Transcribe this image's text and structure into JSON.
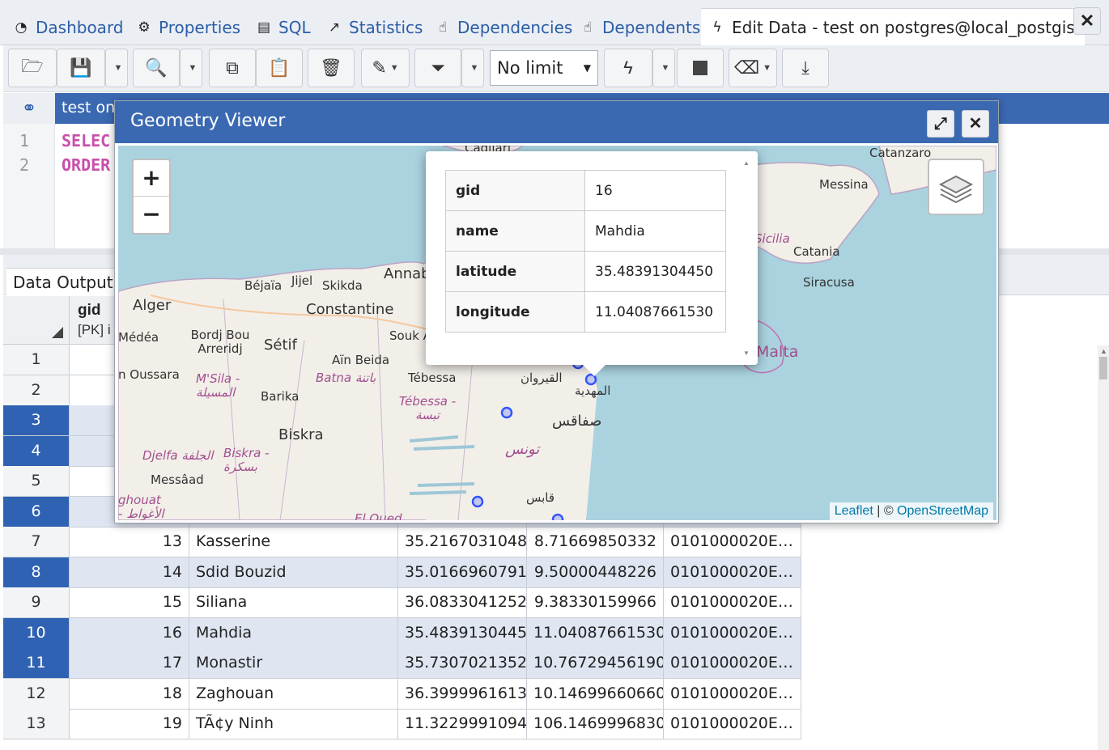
{
  "tabs": [
    {
      "label": "Dashboard",
      "icon": "dashboard-icon"
    },
    {
      "label": "Properties",
      "icon": "gears-icon"
    },
    {
      "label": "SQL",
      "icon": "file-icon"
    },
    {
      "label": "Statistics",
      "icon": "line-chart-icon"
    },
    {
      "label": "Dependencies",
      "icon": "hand-icon"
    },
    {
      "label": "Dependents",
      "icon": "hand-icon"
    },
    {
      "label": "Edit Data - test on postgres@local_postgis",
      "icon": "bolt-icon"
    }
  ],
  "toolbar": {
    "limit_value": "No limit"
  },
  "editor": {
    "connection_label": "test on",
    "lines": [
      {
        "num": "1",
        "text": "SELEC"
      },
      {
        "num": "2",
        "text": "ORDER"
      }
    ]
  },
  "data_output": {
    "tab_label": "Data Output",
    "columns": {
      "gid_name": "gid",
      "gid_type": "[PK] i"
    },
    "rows": [
      {
        "num": "1",
        "selected": false,
        "gid": "",
        "name": "",
        "lat": "",
        "lon": "",
        "geom": ""
      },
      {
        "num": "2",
        "selected": false,
        "gid": "",
        "name": "",
        "lat": "",
        "lon": "",
        "geom": ""
      },
      {
        "num": "3",
        "selected": true,
        "gid": "",
        "name": "",
        "lat": "",
        "lon": "",
        "geom": ""
      },
      {
        "num": "4",
        "selected": true,
        "gid": "",
        "name": "",
        "lat": "",
        "lon": "",
        "geom": ""
      },
      {
        "num": "5",
        "selected": false,
        "gid": "",
        "name": "",
        "lat": "",
        "lon": "",
        "geom": ""
      },
      {
        "num": "6",
        "selected": true,
        "gid": "",
        "name": "",
        "lat": "",
        "lon": "",
        "geom": ""
      },
      {
        "num": "7",
        "selected": false,
        "gid": "13",
        "name": "Kasserine",
        "lat": "35.21670310480",
        "lon": "8.71669850332",
        "geom": "0101000020E61..."
      },
      {
        "num": "8",
        "selected": true,
        "gid": "14",
        "name": "Sdid Bouzid",
        "lat": "35.01669607910",
        "lon": "9.50000448226",
        "geom": "0101000020E61..."
      },
      {
        "num": "9",
        "selected": false,
        "gid": "15",
        "name": "Siliana",
        "lat": "36.08330412520",
        "lon": "9.38330159966",
        "geom": "0101000020E61..."
      },
      {
        "num": "10",
        "selected": true,
        "gid": "16",
        "name": "Mahdia",
        "lat": "35.48391304450",
        "lon": "11.04087661530",
        "geom": "0101000020E61..."
      },
      {
        "num": "11",
        "selected": true,
        "gid": "17",
        "name": "Monastir",
        "lat": "35.73070213520",
        "lon": "10.76729456190",
        "geom": "0101000020E61..."
      },
      {
        "num": "12",
        "selected": false,
        "gid": "18",
        "name": "Zaghouan",
        "lat": "36.39999616130",
        "lon": "10.14699660660",
        "geom": "0101000020E61..."
      },
      {
        "num": "13",
        "selected": false,
        "gid": "19",
        "name": "TÃ¢y Ninh",
        "lat": "11.32299910940",
        "lon": "106.14699968300",
        "geom": "0101000020E61..."
      }
    ]
  },
  "geometry_viewer": {
    "title": "Geometry Viewer",
    "zoom_in": "+",
    "zoom_out": "−",
    "popup": [
      {
        "key": "gid",
        "value": "16"
      },
      {
        "key": "name",
        "value": "Mahdia"
      },
      {
        "key": "latitude",
        "value": "35.48391304450"
      },
      {
        "key": "longitude",
        "value": "11.04087661530"
      }
    ],
    "attribution": {
      "leaflet": "Leaflet",
      "sep": " | © ",
      "osm": "OpenStreetMap"
    },
    "map_labels": [
      "Cagliari",
      "Catanzaro",
      "Messina",
      "Sicilia",
      "Catania",
      "Siracusa",
      "Malta",
      "Alger",
      "Béjaïa",
      "Jijel",
      "Skikda",
      "Annaba",
      "Constantine",
      "Médéa",
      "Bordj Bou Arreridj",
      "Sétif",
      "Souk A",
      "Aïn Beida",
      "n Oussara",
      "M'Sila - المسيلة",
      "Batna باتنة",
      "Tébessa",
      "القيروان",
      "المهدية",
      "Barika",
      "Tébessa - تبسة",
      "صفاقس",
      "Biskra",
      "تونس",
      "Djelfa الجلفة",
      "Biskra - بسكرة",
      "Messâad",
      "ghouat - الأغواط",
      "قابس",
      "El Oued"
    ]
  },
  "colors": {
    "accent": "#3a69b2",
    "link": "#2b5ea7",
    "selection": "#2f62b3",
    "sea": "#aad3df",
    "land": "#f2efe9",
    "point": "#3355ff"
  }
}
